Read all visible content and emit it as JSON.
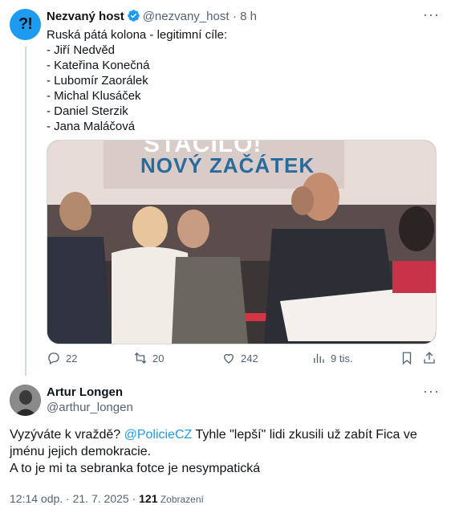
{
  "tweet1": {
    "avatar_text": "?!",
    "author_name": "Nezvaný host",
    "handle": "@nezvany_host",
    "time": "· 8 h",
    "text_lines": [
      "Ruská pátá kolona - legitimní cíle:",
      "- Jiří Nedvěd",
      "- Kateřina Konečná",
      "- Lubomír Zaorálek",
      "- Michal Klusáček",
      "- Daniel Sterzik",
      "- Jana Maláčová"
    ],
    "media_banner_top": "STAČILO!",
    "media_banner": "NOVÝ ZAČÁTEK",
    "actions": {
      "replies": "22",
      "reposts": "20",
      "likes": "242",
      "views": "9 tis."
    }
  },
  "tweet2": {
    "author_name": "Artur Longen",
    "handle": "@arthur_longen",
    "text_line1_prefix": "Vyzýváte k vraždě? ",
    "mention": "@PolicieCZ",
    "text_line1_suffix": " Tyhle \"lepší\" lidi zkusili už zabít Fica ve",
    "text_line2": "jménu jejich demokracie.",
    "text_line3": "A to je mi ta sebranka fotce je nesympatická",
    "timestamp": "12:14 odp. · 21. 7. 2025 · ",
    "views_count": "121",
    "views_label": " Zobrazení"
  },
  "colors": {
    "accent": "#1d9bf0",
    "muted": "#536471",
    "text": "#0f1419"
  }
}
